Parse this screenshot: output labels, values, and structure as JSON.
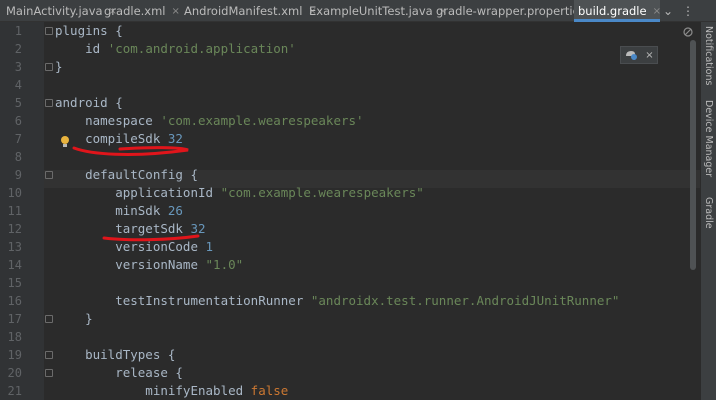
{
  "tabs": [
    {
      "label": "MainActivity.java",
      "icon": "java-class-icon",
      "active": false
    },
    {
      "label": "gradle.xml",
      "icon": "xml-file-icon",
      "active": false
    },
    {
      "label": "AndroidManifest.xml",
      "icon": "manifest-file-icon",
      "active": false
    },
    {
      "label": "ExampleUnitTest.java",
      "icon": "java-class-icon",
      "active": false
    },
    {
      "label": "gradle-wrapper.properties",
      "icon": "properties-file-icon",
      "active": false
    },
    {
      "label": "build.gradle",
      "icon": "gradle-elephant-icon",
      "active": true
    }
  ],
  "tab_close_glyph": "×",
  "tab_overflow_glyph": "⌄",
  "tab_menu_glyph": "⋮",
  "line_numbers": [
    "1",
    "2",
    "3",
    "4",
    "5",
    "6",
    "7",
    "8",
    "9",
    "10",
    "11",
    "12",
    "13",
    "14",
    "15",
    "16",
    "17",
    "18",
    "19",
    "20",
    "21"
  ],
  "code_lines": [
    [
      {
        "t": "plugins {",
        "c": ""
      }
    ],
    [
      {
        "t": "    id ",
        "c": ""
      },
      {
        "t": "'com.android.application'",
        "c": "str"
      }
    ],
    [
      {
        "t": "}",
        "c": ""
      }
    ],
    [
      {
        "t": "",
        "c": ""
      }
    ],
    [
      {
        "t": "android {",
        "c": ""
      }
    ],
    [
      {
        "t": "    namespace ",
        "c": ""
      },
      {
        "t": "'com.example.wearespeakers'",
        "c": "str"
      }
    ],
    [
      {
        "t": "    compileSdk ",
        "c": ""
      },
      {
        "t": "32",
        "c": "num"
      }
    ],
    [
      {
        "t": "",
        "c": ""
      }
    ],
    [
      {
        "t": "    defaultConfig {",
        "c": ""
      }
    ],
    [
      {
        "t": "        applicationId ",
        "c": ""
      },
      {
        "t": "\"com.example.wearespeakers\"",
        "c": "str"
      }
    ],
    [
      {
        "t": "        minSdk ",
        "c": ""
      },
      {
        "t": "26",
        "c": "num"
      }
    ],
    [
      {
        "t": "        targetSdk ",
        "c": ""
      },
      {
        "t": "32",
        "c": "num"
      }
    ],
    [
      {
        "t": "        versionCode ",
        "c": ""
      },
      {
        "t": "1",
        "c": "num"
      }
    ],
    [
      {
        "t": "        versionName ",
        "c": ""
      },
      {
        "t": "\"1.0\"",
        "c": "str"
      }
    ],
    [
      {
        "t": "",
        "c": ""
      }
    ],
    [
      {
        "t": "        testInstrumentationRunner ",
        "c": ""
      },
      {
        "t": "\"androidx.test.runner.AndroidJUnitRunner\"",
        "c": "str"
      }
    ],
    [
      {
        "t": "    }",
        "c": ""
      }
    ],
    [
      {
        "t": "",
        "c": ""
      }
    ],
    [
      {
        "t": "    buildTypes {",
        "c": ""
      }
    ],
    [
      {
        "t": "        release {",
        "c": ""
      }
    ],
    [
      {
        "t": "            minifyEnabled ",
        "c": ""
      },
      {
        "t": "false",
        "c": "kw"
      }
    ]
  ],
  "right_panel": {
    "notifications": "Notifications",
    "device_manager": "Device Manager",
    "gradle": "Gradle"
  },
  "colors": {
    "editor_bg": "#2b2b2b",
    "gutter_bg": "#313335",
    "string": "#6a8759",
    "number": "#6897bb",
    "keyword": "#cc7832",
    "annotation_marker": "#e0151b"
  },
  "annotations": [
    "red-underline-compileSdk",
    "red-underline-targetSdk"
  ]
}
